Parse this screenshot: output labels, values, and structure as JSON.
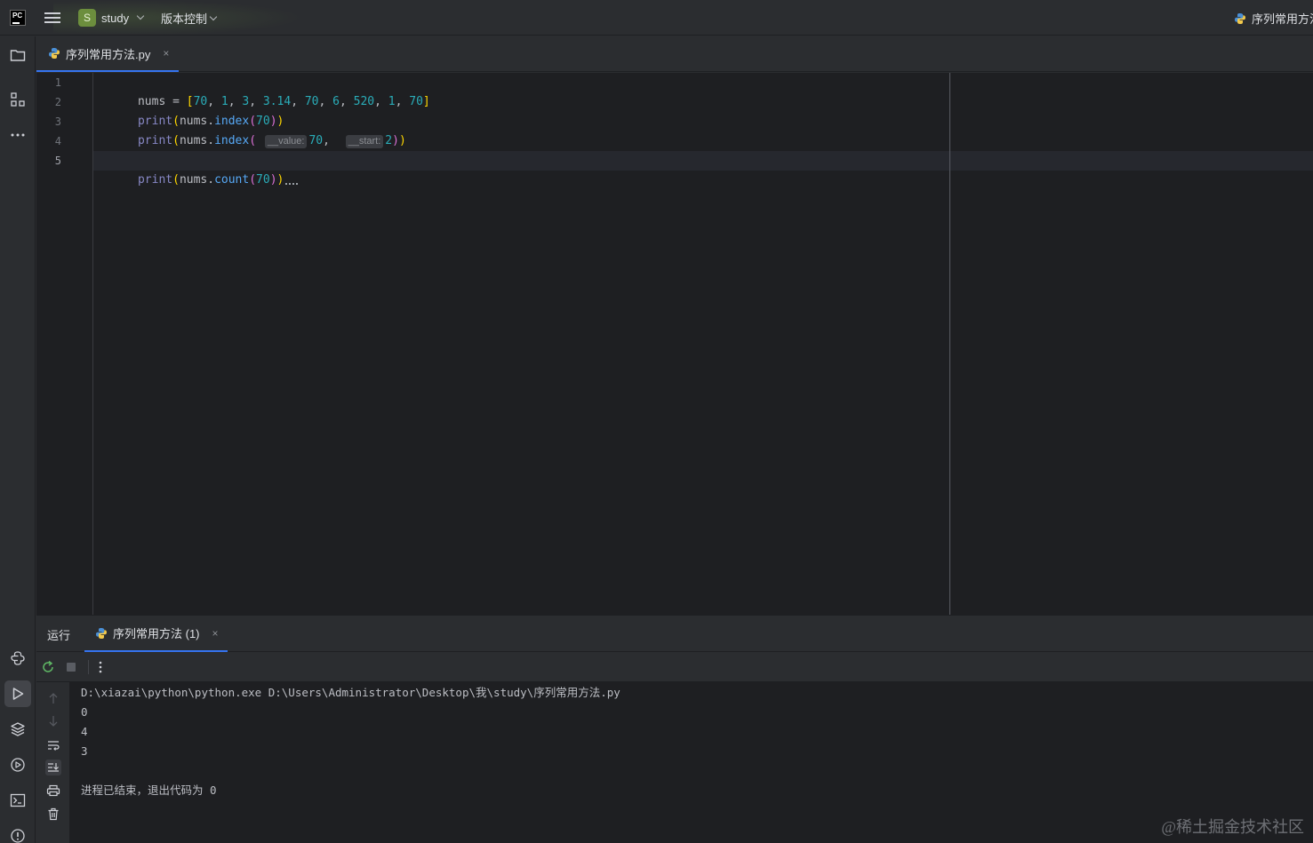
{
  "titlebar": {
    "logo_text": "PC",
    "project_initial": "S",
    "project_name": "study",
    "vcs_label": "版本控制",
    "run_config": "序列常用方法"
  },
  "editor_tab": {
    "filename": "序列常用方法.py",
    "close": "×"
  },
  "code": {
    "line_numbers": [
      "1",
      "2",
      "3",
      "4",
      "5"
    ],
    "current_line": 5,
    "line1": {
      "var": "nums",
      "eq": " = ",
      "lb": "[",
      "items": [
        "70",
        "1",
        "3",
        "3.14",
        "70",
        "6",
        "520",
        "1",
        "70"
      ],
      "rb": "]"
    },
    "line2": {
      "fn": "print",
      "obj": "nums",
      "method": "index",
      "arg": "70"
    },
    "line3": {
      "fn": "print",
      "obj": "nums",
      "method": "index",
      "hint1": "__value:",
      "arg1": "70",
      "hint2": "__start:",
      "arg2": "2"
    },
    "line5": {
      "fn": "print",
      "obj": "nums",
      "method": "count",
      "arg": "70"
    }
  },
  "run_panel": {
    "label": "运行",
    "tab_title": "序列常用方法 (1)",
    "close": "×",
    "console_lines": [
      "D:\\xiazai\\python\\python.exe D:\\Users\\Administrator\\Desktop\\我\\study\\序列常用方法.py",
      "0",
      "4",
      "3",
      "",
      "进程已结束，退出代码为 0"
    ],
    "exit_code": "0"
  },
  "watermark": "@稀土掘金技术社区",
  "colors": {
    "accent": "#3574f0",
    "background": "#1e1f22",
    "panel": "#2b2d30",
    "number": "#2aacb8",
    "function": "#56a8f5",
    "builtin": "#8888c6",
    "bracket": "#ffd700"
  },
  "icons": [
    "pycharm-logo-icon",
    "hamburger-menu-icon",
    "python-file-icon",
    "folder-icon",
    "structure-icon",
    "more-icon",
    "python-console-icon",
    "run-icon",
    "layers-icon",
    "services-icon",
    "terminal-icon",
    "problems-icon",
    "rerun-icon",
    "stop-icon",
    "up-arrow-icon",
    "down-arrow-icon",
    "soft-wrap-icon",
    "scroll-to-end-icon",
    "print-icon",
    "trash-icon"
  ]
}
